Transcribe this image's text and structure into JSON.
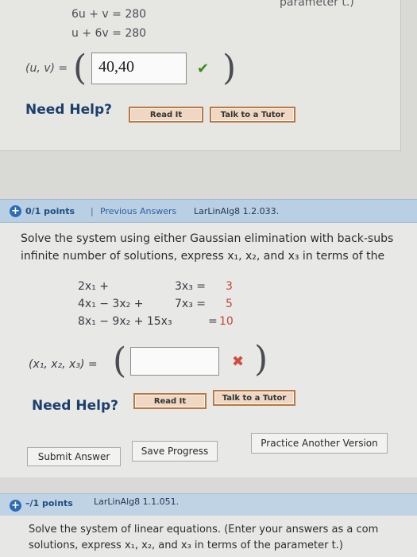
{
  "problem1": {
    "cutoff_text": "parameter t.)",
    "equations": [
      "6u + v = 280",
      "u + 6v = 280"
    ],
    "answer_label": "(u, v) =",
    "answer_value": "40,40",
    "status_icon": "check-icon",
    "help_label": "Need Help?",
    "read_it": "Read It",
    "talk_tutor": "Talk to a Tutor"
  },
  "problem2": {
    "points": "0/1 points",
    "separator": "|",
    "previous_answers": "Previous Answers",
    "code": "LarLinAlg8 1.2.033.",
    "prompt_line1": "Solve the system using either Gaussian elimination with back-subs",
    "prompt_line2": "infinite number of solutions, express x₁, x₂, and x₃ in terms of the",
    "system": {
      "row1": {
        "left": "2x₁ +",
        "right": "3x₃ =",
        "rhs": "3"
      },
      "row2": {
        "left": "4x₁ − 3x₂ +",
        "right": "7x₃ =",
        "rhs": "5"
      },
      "row3": {
        "left": "8x₁ − 9x₂ + 15x₃",
        "right": "=",
        "rhs": "10"
      }
    },
    "answer_label": "(x₁, x₂, x₃) =",
    "answer_value": "",
    "status_icon": "cross-icon",
    "help_label": "Need Help?",
    "read_it": "Read It",
    "talk_tutor": "Talk to a Tutor",
    "submit": "Submit Answer",
    "save": "Save Progress",
    "practice": "Practice Another Version"
  },
  "problem3": {
    "points": "–/1 points",
    "code": "LarLinAlg8 1.1.051.",
    "prompt_line1": "Solve the system of linear equations. (Enter your answers as a com",
    "prompt_line2": "solutions, express x₁, x₂, and x₃ in terms of the parameter t.)"
  }
}
